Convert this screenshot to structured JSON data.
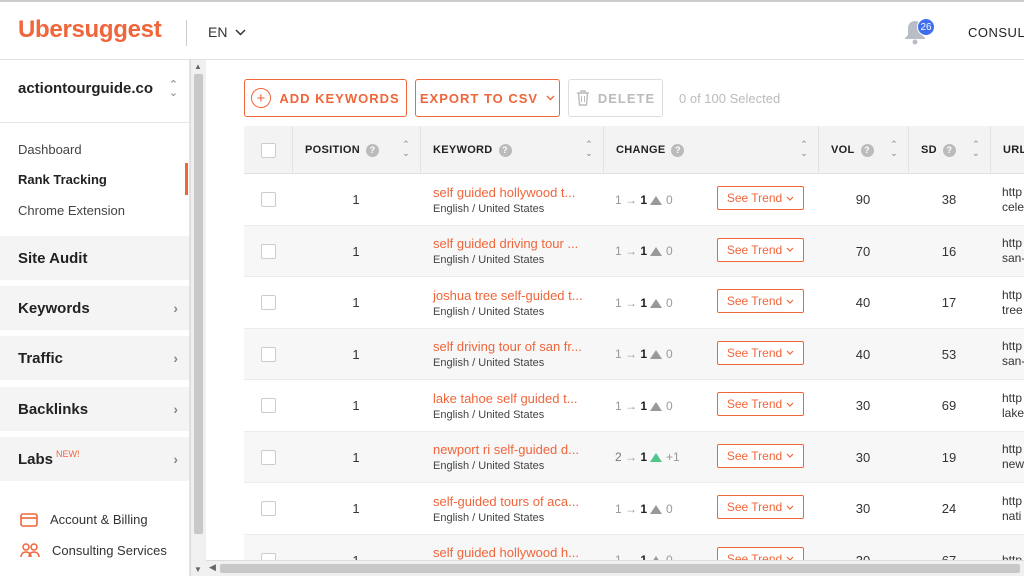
{
  "header": {
    "logo": "Ubersuggest",
    "language": "EN",
    "notifications_count": "26",
    "consult_label": "CONSULT"
  },
  "sidebar": {
    "project": "actiontourguide.co",
    "subitems": [
      {
        "label": "Dashboard",
        "active": false
      },
      {
        "label": "Rank Tracking",
        "active": true
      },
      {
        "label": "Chrome Extension",
        "active": false
      }
    ],
    "sections": [
      {
        "label": "Site Audit",
        "has_arrow": false,
        "tag": ""
      },
      {
        "label": "Keywords",
        "has_arrow": true,
        "tag": ""
      },
      {
        "label": "Traffic",
        "has_arrow": true,
        "tag": ""
      },
      {
        "label": "Backlinks",
        "has_arrow": true,
        "tag": ""
      },
      {
        "label": "Labs",
        "has_arrow": true,
        "tag": "NEW!"
      }
    ],
    "footer": [
      {
        "label": "Account & Billing",
        "icon": "card-icon"
      },
      {
        "label": "Consulting Services",
        "icon": "people-icon"
      }
    ]
  },
  "toolbar": {
    "add_keywords": "ADD KEYWORDS",
    "export_csv": "EXPORT TO CSV",
    "delete": "DELETE",
    "selected_text": "0 of 100 Selected"
  },
  "table": {
    "columns": {
      "position": "POSITION",
      "keyword": "KEYWORD",
      "change": "CHANGE",
      "vol": "VOL",
      "sd": "SD",
      "url": "URL"
    },
    "trend_label": "See Trend",
    "rows": [
      {
        "position": "1",
        "keyword": "self guided hollywood t...",
        "location": "English / United States",
        "from": "1",
        "to": "1",
        "delta": "0",
        "delta_up": false,
        "vol": "90",
        "sd": "38",
        "url1": "http",
        "url2": "cele"
      },
      {
        "position": "1",
        "keyword": "self guided driving tour ...",
        "location": "English / United States",
        "from": "1",
        "to": "1",
        "delta": "0",
        "delta_up": false,
        "vol": "70",
        "sd": "16",
        "url1": "http",
        "url2": "san-"
      },
      {
        "position": "1",
        "keyword": "joshua tree self-guided t...",
        "location": "English / United States",
        "from": "1",
        "to": "1",
        "delta": "0",
        "delta_up": false,
        "vol": "40",
        "sd": "17",
        "url1": "http",
        "url2": "tree"
      },
      {
        "position": "1",
        "keyword": "self driving tour of san fr...",
        "location": "English / United States",
        "from": "1",
        "to": "1",
        "delta": "0",
        "delta_up": false,
        "vol": "40",
        "sd": "53",
        "url1": "http",
        "url2": "san-"
      },
      {
        "position": "1",
        "keyword": "lake tahoe self guided t...",
        "location": "English / United States",
        "from": "1",
        "to": "1",
        "delta": "0",
        "delta_up": false,
        "vol": "30",
        "sd": "69",
        "url1": "http",
        "url2": "lake"
      },
      {
        "position": "1",
        "keyword": "newport ri self-guided d...",
        "location": "English / United States",
        "from": "2",
        "to": "1",
        "delta": "+1",
        "delta_up": true,
        "vol": "30",
        "sd": "19",
        "url1": "http",
        "url2": "new"
      },
      {
        "position": "1",
        "keyword": "self-guided tours of aca...",
        "location": "English / United States",
        "from": "1",
        "to": "1",
        "delta": "0",
        "delta_up": false,
        "vol": "30",
        "sd": "24",
        "url1": "http",
        "url2": "nati"
      },
      {
        "position": "1",
        "keyword": "self guided hollywood h...",
        "location": "English / United States",
        "from": "1",
        "to": "1",
        "delta": "0",
        "delta_up": false,
        "vol": "30",
        "sd": "67",
        "url1": "http",
        "url2": ""
      }
    ]
  },
  "colors": {
    "brand": "#f0653a",
    "badge": "#3d6ff0",
    "up": "#4fc38a"
  }
}
